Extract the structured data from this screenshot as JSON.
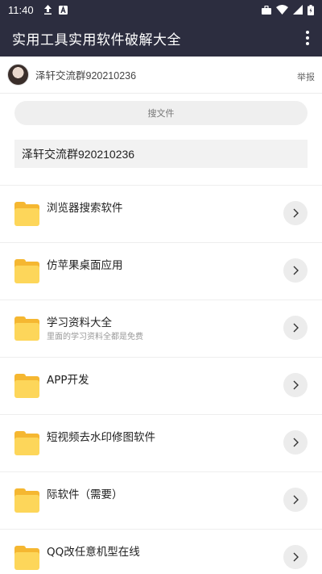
{
  "status_bar": {
    "time": "11:40",
    "icons_left": [
      "upload-icon",
      "a-icon"
    ],
    "icons_right": [
      "briefcase-icon",
      "wifi-icon",
      "signal-icon",
      "battery-icon"
    ]
  },
  "app_bar": {
    "title": "实用工具实用软件破解大全",
    "menu_icon": "more-vert-icon",
    "background": "#2c2d3f"
  },
  "user": {
    "name": "泽轩交流群920210236",
    "report_label": "举报"
  },
  "search": {
    "placeholder": "搜文件"
  },
  "group_info": {
    "text": "泽轩交流群920210236"
  },
  "files": [
    {
      "title": "浏览器搜索软件",
      "subtitle": ""
    },
    {
      "title": "仿苹果桌面应用",
      "subtitle": ""
    },
    {
      "title": "学习资料大全",
      "subtitle": "里面的学习资料全都是免费"
    },
    {
      "title": "APP开发",
      "subtitle": ""
    },
    {
      "title": "短视频去水印修图软件",
      "subtitle": ""
    },
    {
      "title": "际软件（需要）",
      "subtitle": ""
    },
    {
      "title": "QQ改任意机型在线",
      "subtitle": ""
    }
  ],
  "colors": {
    "folder_back": "#f5b731",
    "folder_front": "#fdd65a",
    "arrow_bg": "#ececec"
  }
}
